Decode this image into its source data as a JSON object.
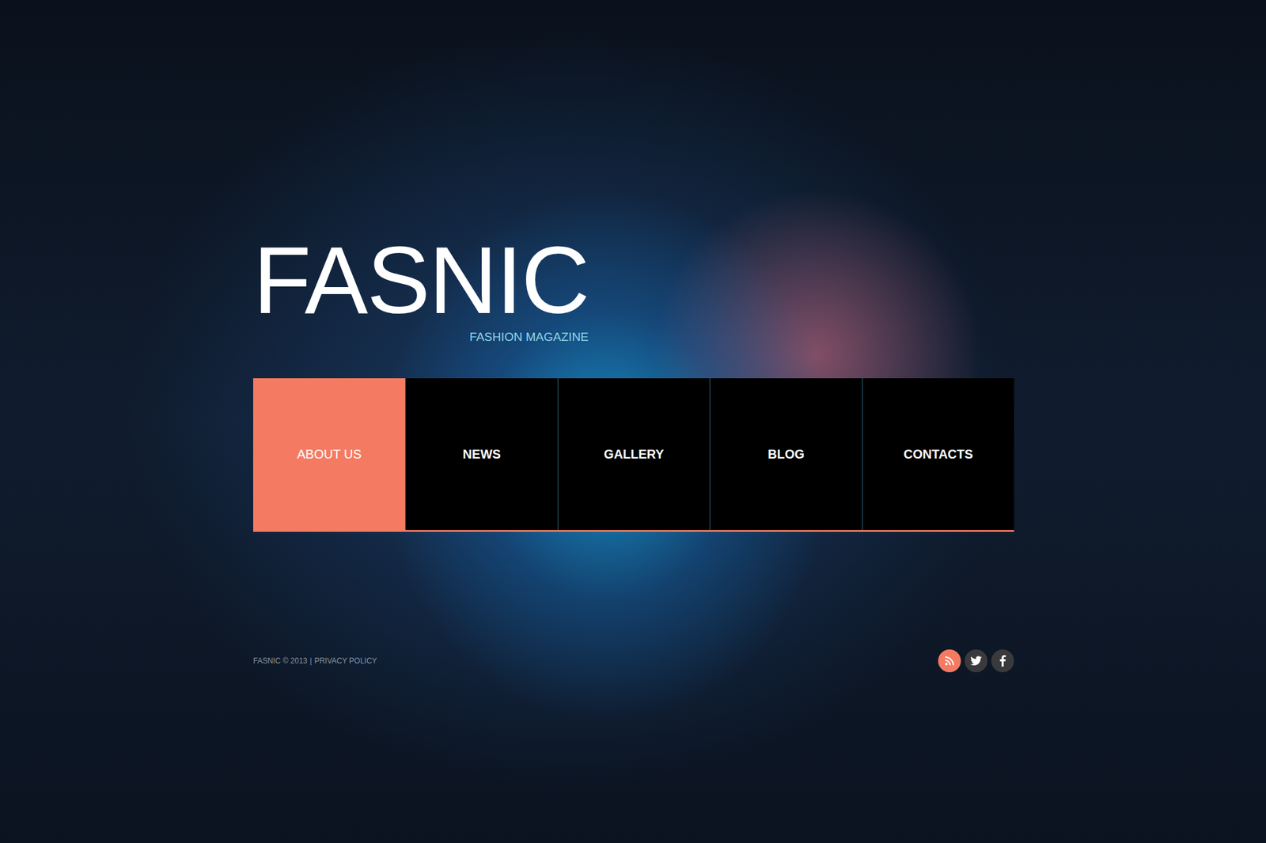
{
  "logo": {
    "title": "FASNIC",
    "subtitle": "FASHION MAGAZINE"
  },
  "nav": [
    {
      "label": "ABOUT US",
      "selected": true
    },
    {
      "label": "NEWS",
      "selected": false
    },
    {
      "label": "GALLERY",
      "selected": false
    },
    {
      "label": "BLOG",
      "selected": false
    },
    {
      "label": "CONTACTS",
      "selected": false
    }
  ],
  "footer": {
    "copyright": "FASNIC © 2013",
    "divider": "|",
    "link": "PRIVACY POLICY"
  },
  "social": [
    {
      "kind": "rss",
      "color": "#f47b62"
    },
    {
      "kind": "twitter",
      "color": "#3a3a3c"
    },
    {
      "kind": "facebook",
      "color": "#3a3a3c"
    }
  ]
}
